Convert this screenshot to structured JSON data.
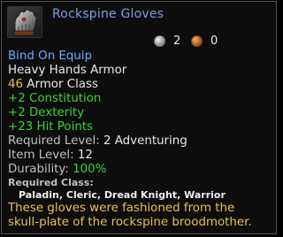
{
  "item": {
    "name": "Rockspine Gloves",
    "icon": "gauntlet-icon",
    "price": {
      "silver": "2",
      "copper": "0"
    }
  },
  "lines": {
    "bind": "Bind On Equip",
    "type": "Heavy Hands Armor",
    "armor_value": "46",
    "armor_label": " Armor Class",
    "stat1": "+2 Constitution",
    "stat2": "+2 Dexterity",
    "stat3": "+23 Hit Points",
    "req_level_label": "Required Level: ",
    "req_level_value": "2 Adventuring",
    "item_level_label": "Item Level: ",
    "item_level_value": "12",
    "durability_label": "Durability: ",
    "durability_value": "100%",
    "req_class_label": "Required Class:",
    "req_class_value": "Paladin, Cleric, Dread Knight, Warrior"
  },
  "description": [
    "These gloves were fashioned from the",
    "skull-plate of the rockspine broodmother."
  ],
  "colors": {
    "name": "#7a9de8",
    "bind": "#6fa8ff",
    "bonus": "#35d335",
    "highlight": "#e8c24a"
  }
}
